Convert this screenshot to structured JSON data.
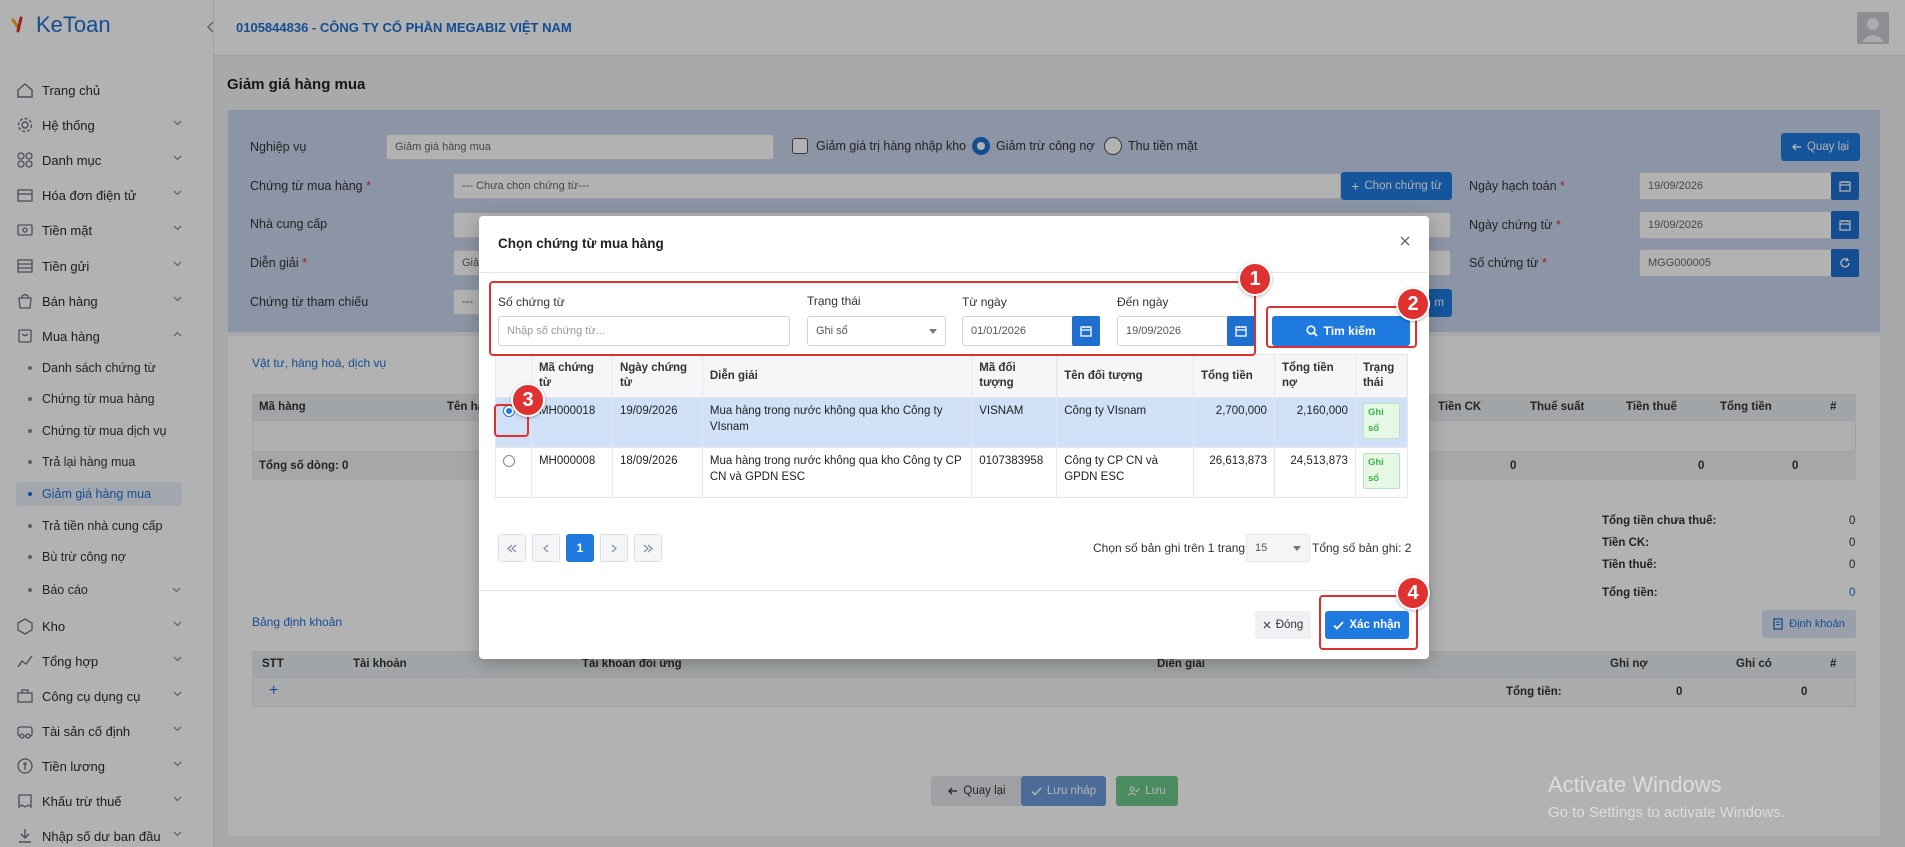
{
  "brand": {
    "name": "KeToan"
  },
  "header": {
    "company": "0105844836 - CÔNG TY CỔ PHẦN MEGABIZ VIỆT NAM"
  },
  "sidebar": {
    "items": [
      {
        "label": "Trang chủ"
      },
      {
        "label": "Hệ thống"
      },
      {
        "label": "Danh mục"
      },
      {
        "label": "Hóa đơn điện tử"
      },
      {
        "label": "Tiền mặt"
      },
      {
        "label": "Tiền gửi"
      },
      {
        "label": "Bán hàng"
      },
      {
        "label": "Mua hàng"
      },
      {
        "label": "Kho"
      },
      {
        "label": "Tổng hợp"
      },
      {
        "label": "Công cụ dụng cụ"
      },
      {
        "label": "Tài sản cố định"
      },
      {
        "label": "Tiền lương"
      },
      {
        "label": "Khấu trừ thuế"
      },
      {
        "label": "Nhập số dư ban đầu"
      }
    ],
    "sub": [
      {
        "label": "Danh sách chứng từ"
      },
      {
        "label": "Chứng từ mua hàng"
      },
      {
        "label": "Chứng từ mua dịch vụ"
      },
      {
        "label": "Trả lại hàng mua"
      },
      {
        "label": "Giảm giá hàng mua"
      },
      {
        "label": "Trả tiền nhà cung cấp"
      },
      {
        "label": "Bù trừ công nợ"
      },
      {
        "label": "Báo cáo"
      }
    ]
  },
  "page": {
    "title": "Giảm giá hàng mua"
  },
  "form": {
    "nghiep_vu_label": "Nghiệp vụ",
    "nghiep_vu_value": "Giảm giá hàng mua",
    "cb_nhap_kho": "Giảm giá trị hàng nhập kho",
    "rb_tru_cong_no": "Giảm trừ công nợ",
    "rb_thu_tien_mat": "Thu tiền mặt",
    "back_btn": "Quay lại",
    "chung_tu_label": "Chứng từ mua hàng",
    "chung_tu_placeholder": "--- Chưa chọn chứng từ---",
    "chon_chung_tu_btn": "Chọn chứng từ",
    "nha_cung_cap_label": "Nhà cung cấp",
    "dien_giai_label": "Diễn giải",
    "dien_giai_value": "Giả",
    "tham_chieu_label": "Chứng từ tham chiếu",
    "tham_chieu_value": "---",
    "hidden_btn_fragment": "m",
    "ngay_hach_toan_label": "Ngày hạch toán",
    "ngay_hach_toan_value": "19/09/2026",
    "ngay_chung_tu_label": "Ngày chứng từ",
    "ngay_chung_tu_value": "19/09/2026",
    "so_chung_tu_label": "Số chứng từ",
    "so_chung_tu_value": "MGG000005",
    "required_mark": "*"
  },
  "items_section": {
    "title": "Vật tư, hàng hoá, dịch vụ",
    "cols": [
      "Mã hàng",
      "Tên hà",
      "Tiền CK",
      "Thuế suất",
      "Tiền thuế",
      "Tổng tiền",
      "#"
    ],
    "total_rows_label": "Tổng số dòng: 0",
    "totals_row": [
      "0",
      "0",
      "0"
    ]
  },
  "summary": {
    "chua_thue_label": "Tổng tiền chưa thuế:",
    "chua_thue_value": "0",
    "ck_label": "Tiền CK:",
    "ck_value": "0",
    "thue_label": "Tiền thuế:",
    "thue_value": "0",
    "tong_label": "Tổng tiền:",
    "tong_value": "0"
  },
  "accounting": {
    "title": "Bảng định khoản",
    "dinh_khoan_btn": "Định khoản",
    "cols": [
      "STT",
      "Tài khoản",
      "Tài khoản đối ứng",
      "Diễn giải",
      "Ghi nợ",
      "Ghi có",
      "#"
    ],
    "add": "+",
    "total_label": "Tổng tiền:",
    "total_no": "0",
    "total_co": "0"
  },
  "footer": {
    "back": "Quay lại",
    "draft": "Lưu nháp",
    "save": "Lưu"
  },
  "watermark": {
    "line1": "Activate Windows",
    "line2": "Go to Settings to activate Windows."
  },
  "modal": {
    "title": "Chọn chứng từ mua hàng",
    "so_chung_tu_label": "Số chứng từ",
    "so_chung_tu_placeholder": "Nhập số chứng từ...",
    "trang_thai_label": "Trạng thái",
    "trang_thai_value": "Ghi sổ",
    "tu_ngay_label": "Từ ngày",
    "tu_ngay_value": "01/01/2026",
    "den_ngay_label": "Đến ngày",
    "den_ngay_value": "19/09/2026",
    "search_btn": "Tìm kiếm",
    "cols": [
      "Mã chứng từ",
      "Ngày chứng từ",
      "Diễn giải",
      "Mã đối tượng",
      "Tên đối tượng",
      "Tổng tiền",
      "Tổng tiền nợ",
      "Trạng thái"
    ],
    "rows": [
      {
        "ma": "MH000018",
        "ngay": "19/09/2026",
        "dien_giai": "Mua hàng trong nước không qua kho Công ty VIsnam",
        "ma_dt": "VISNAM",
        "ten_dt": "Công ty VIsnam",
        "tong": "2,700,000",
        "tong_no": "2,160,000",
        "trang_thai": "Ghi sổ"
      },
      {
        "ma": "MH000008",
        "ngay": "18/09/2026",
        "dien_giai": "Mua hàng trong nước không qua kho Công ty CP CN và GPDN ESC",
        "ma_dt": "0107383958",
        "ten_dt": "Công ty CP CN và GPDN ESC",
        "tong": "26,613,873",
        "tong_no": "24,513,873",
        "trang_thai": "Ghi sổ"
      }
    ],
    "page_current": "1",
    "per_page_label": "Chọn số bản ghi trên 1 trang:",
    "per_page_value": "15",
    "total_label": "Tổng số bản ghi:",
    "total_value": "2",
    "close_btn": "Đóng",
    "confirm_btn": "Xác nhận"
  },
  "callouts": [
    "1",
    "2",
    "3",
    "4"
  ],
  "colors": {
    "primary": "#1f7ae0",
    "callout": "#e03131",
    "status_green": "#3bb54a"
  }
}
